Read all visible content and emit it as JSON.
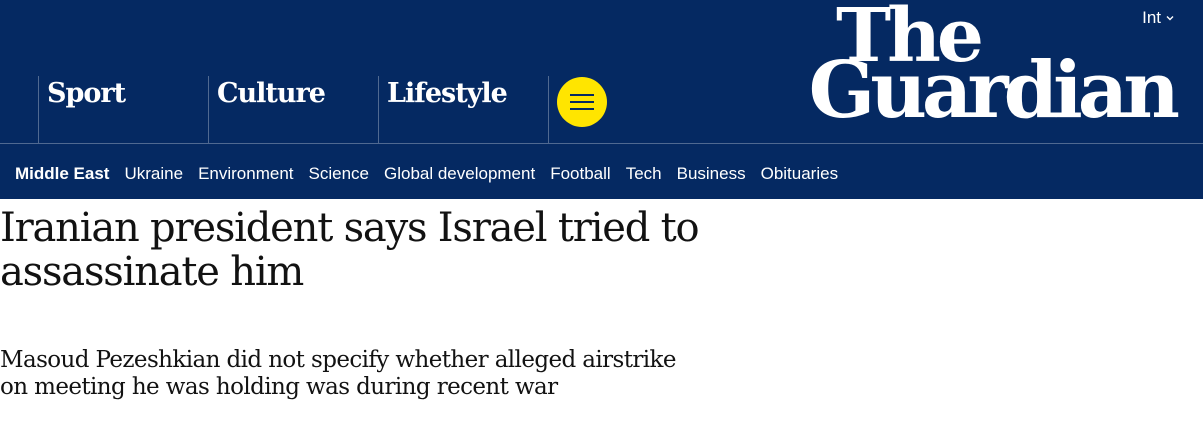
{
  "masthead": {
    "edition_label": "Int",
    "logo_line1": "The",
    "logo_line2": "Guardian",
    "pillars": [
      {
        "label": "Sport"
      },
      {
        "label": "Culture"
      },
      {
        "label": "Lifestyle"
      }
    ],
    "menu_icon": "hamburger-menu-icon",
    "colors": {
      "background": "#052962",
      "menu_button": "#ffe500",
      "divider": "#506991",
      "text": "#ffffff"
    }
  },
  "subnav": {
    "items": [
      {
        "label": "Middle East",
        "active": true
      },
      {
        "label": "Ukraine"
      },
      {
        "label": "Environment"
      },
      {
        "label": "Science"
      },
      {
        "label": "Global development"
      },
      {
        "label": "Football"
      },
      {
        "label": "Tech"
      },
      {
        "label": "Business"
      },
      {
        "label": "Obituaries"
      }
    ]
  },
  "article": {
    "headline": "Iranian president says Israel tried to assassinate him",
    "standfirst": "Masoud Pezeshkian did not specify whether alleged airstrike on meeting he was holding was during recent war"
  }
}
